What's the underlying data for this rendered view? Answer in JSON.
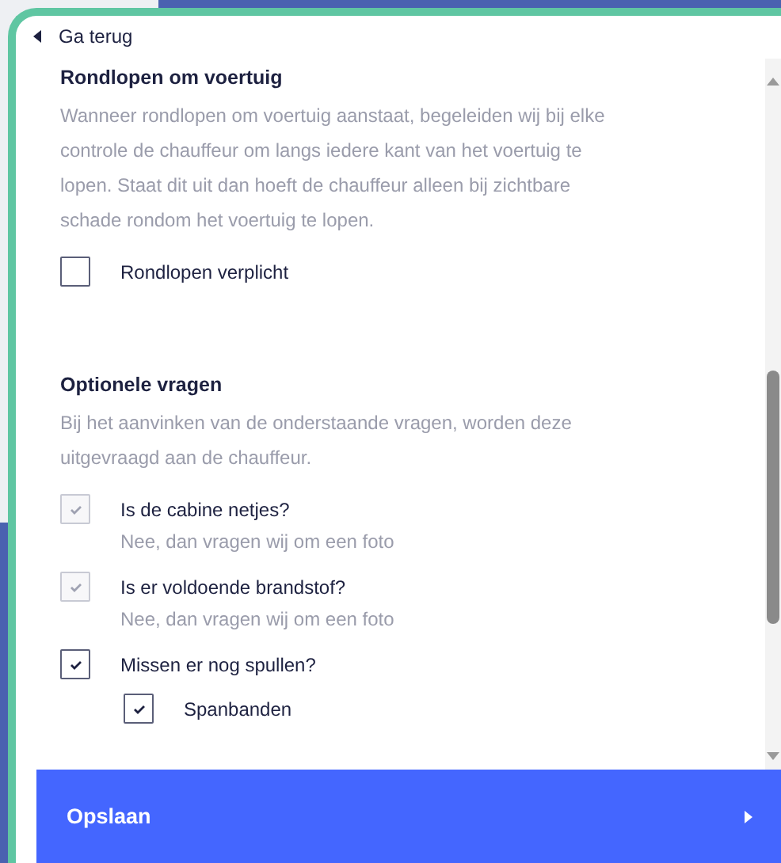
{
  "back_link": {
    "label": "Ga terug"
  },
  "sections": [
    {
      "title": "Rondlopen om voertuig",
      "description": "Wanneer rondlopen om voertuig aanstaat, begeleiden wij bij elke controle de chauffeur om langs iedere kant van het voertuig te lopen. Staat dit uit dan hoeft de chauffeur alleen bij zichtbare schade rondom het voertuig te lopen.",
      "options": [
        {
          "label": "Rondlopen verplicht",
          "checked": false,
          "disabled": false
        }
      ]
    },
    {
      "title": "Optionele vragen",
      "description": "Bij het aanvinken van de onderstaande vragen, worden deze uitgevraagd aan de chauffeur.",
      "options": [
        {
          "label": "Is de cabine netjes?",
          "hint": "Nee, dan vragen wij om een foto",
          "checked": true,
          "disabled": true
        },
        {
          "label": "Is er voldoende brandstof?",
          "hint": "Nee, dan vragen wij om een foto",
          "checked": true,
          "disabled": true
        },
        {
          "label": "Missen er nog spullen?",
          "checked": true,
          "disabled": false,
          "children": [
            {
              "label": "Spanbanden",
              "checked": true,
              "disabled": false
            }
          ]
        }
      ]
    }
  ],
  "save_button": {
    "label": "Opslaan"
  }
}
